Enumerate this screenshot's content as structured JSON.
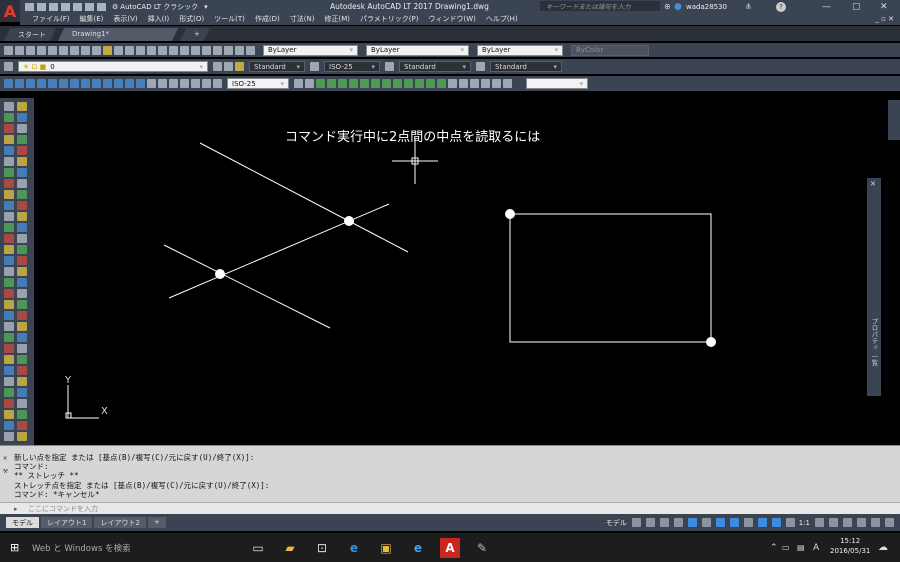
{
  "title_bar": {
    "app_letter": "A",
    "workspace": "AutoCAD LT クラシック",
    "title": "Autodesk AutoCAD LT 2017    Drawing1.dwg",
    "search_placeholder": "キーワードまたは語句を入力",
    "user": "wada28530",
    "help": "?"
  },
  "menu": [
    "ファイル(F)",
    "編集(E)",
    "表示(V)",
    "挿入(I)",
    "形式(O)",
    "ツール(T)",
    "作成(D)",
    "寸法(N)",
    "修正(M)",
    "パラメトリック(P)",
    "ウィンドウ(W)",
    "ヘルプ(H)"
  ],
  "file_tabs": [
    {
      "label": "スタート"
    },
    {
      "label": "Drawing1*"
    },
    {
      "label": "+"
    }
  ],
  "properties": {
    "color": "ByLayer",
    "linetype": "ByLayer",
    "lineweight": "ByLayer",
    "plotstyle": "ByColor"
  },
  "layer": {
    "current": "0"
  },
  "styles": {
    "text_style": "Standard",
    "dim_style": "ISO-25",
    "table_style": "Standard",
    "mleader_style": "Standard"
  },
  "dim_toolbar": {
    "dim_style": "ISO-25"
  },
  "canvas": {
    "annotation": "コマンド実行中に2点間の中点を読取るには",
    "ucs_x": "X",
    "ucs_y": "Y"
  },
  "command_history": [
    "新しい点を指定 または [基点(B)/複写(C)/元に戻す(U)/終了(X)]:",
    "コマンド:",
    "** ストレッチ **",
    "ストレッチ点を指定 または [基点(B)/複写(C)/元に戻す(U)/終了(X)]:",
    "コマンド: *キャンセル*"
  ],
  "command_input": {
    "placeholder": "ここにコマンドを入力"
  },
  "layout_tabs": [
    {
      "label": "モデル"
    },
    {
      "label": "レイアウト1"
    },
    {
      "label": "レイアウト2"
    },
    {
      "label": "+"
    }
  ],
  "status": {
    "model_label": "モデル",
    "scale": "1:1"
  },
  "right_palette": {
    "label": "プロパティ 一覧"
  },
  "taskbar": {
    "search": "Web と Windows を検索",
    "ime": "A",
    "time": "15:12",
    "date": "2016/05/31"
  },
  "colors": {
    "accent": "#3b4453",
    "crosshair": "#ffffff",
    "osnap": "#ffffff"
  }
}
